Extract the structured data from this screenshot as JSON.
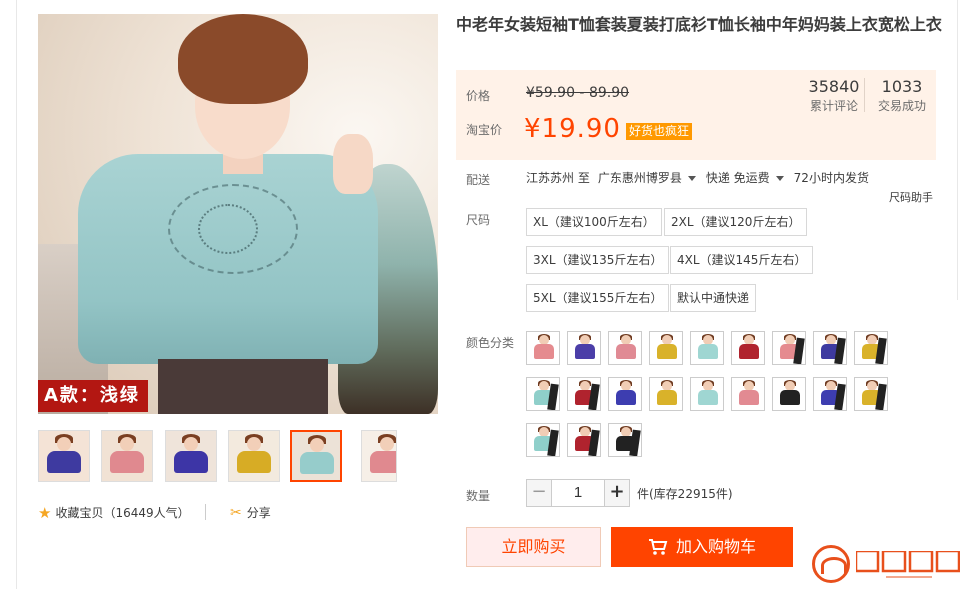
{
  "product": {
    "title": "中老年女装短袖T恤套装夏装打底衫T恤长袖中年妈妈装上衣宽松上衣",
    "image_badge": "A款：浅绿"
  },
  "price": {
    "price_label": "价格",
    "original_price": "¥59.90 - 89.90",
    "taobao_price_label": "淘宝价",
    "current_price": "¥19.90",
    "promo_badge": "好货也疯狂",
    "stats": [
      {
        "number": "35840",
        "caption": "累计评论"
      },
      {
        "number": "1033",
        "caption": "交易成功"
      }
    ]
  },
  "delivery": {
    "label": "配送",
    "from": "江苏苏州 至",
    "to": "广东惠州博罗县",
    "shipping": "快递 免运费",
    "dispatch": "72小时内发货"
  },
  "size": {
    "label": "尺码",
    "helper": "尺码助手",
    "options": [
      "XL（建议100斤左右）",
      "2XL（建议120斤左右）",
      "3XL（建议135斤左右）",
      "4XL（建议145斤左右）",
      "5XL（建议155斤左右）",
      "默认中通快递"
    ]
  },
  "color": {
    "label": "颜色分类",
    "swatches": [
      {
        "top": "#e58b8f",
        "pants": false
      },
      {
        "top": "#4b3ea8",
        "pants": false
      },
      {
        "top": "#e08a94",
        "pants": false
      },
      {
        "top": "#d9b22a",
        "pants": false
      },
      {
        "top": "#9fd6d2",
        "pants": false
      },
      {
        "top": "#b0232e",
        "pants": false
      },
      {
        "top": "#e58b8f",
        "pants": true
      },
      {
        "top": "#3e3aa0",
        "pants": true
      },
      {
        "top": "#d9b22a",
        "pants": true
      },
      {
        "top": "#8fcfca",
        "pants": true
      },
      {
        "top": "#b0232e",
        "pants": true
      },
      {
        "top": "#3d3db0",
        "pants": false
      },
      {
        "top": "#d9b22a",
        "pants": false
      },
      {
        "top": "#9fd6d2",
        "pants": false
      },
      {
        "top": "#e28a92",
        "pants": false
      },
      {
        "top": "#222222",
        "pants": false
      },
      {
        "top": "#3d3db0",
        "pants": true
      },
      {
        "top": "#d9b22a",
        "pants": true
      },
      {
        "top": "#8fcfca",
        "pants": true
      },
      {
        "top": "#b0232e",
        "pants": true
      },
      {
        "top": "#222222",
        "pants": true
      }
    ]
  },
  "quantity": {
    "label": "数量",
    "minus": "−",
    "value": "1",
    "plus": "+",
    "unit_stock": "件(库存22915件)"
  },
  "actions": {
    "buy_now": "立即购买",
    "add_to_cart": "加入购物车"
  },
  "social": {
    "favorite": "收藏宝贝（16449人气）",
    "share": "分享"
  },
  "thumbnails": [
    {
      "top": "#3e3aa0",
      "bg": "#f4e3d6"
    },
    {
      "top": "#e0898f",
      "bg": "#f1e2d4"
    },
    {
      "top": "#3d35a6",
      "bg": "#efe4da"
    },
    {
      "top": "#d7ac25",
      "bg": "#f3eade"
    },
    {
      "top": "#96cccb",
      "bg": "#ece2d7"
    },
    {
      "top": "#e0898f",
      "bg": "#f6efe7"
    }
  ],
  "colors": {
    "accent": "#ff4400",
    "price_bg": "#fff2e8",
    "badge": "#b31712"
  }
}
